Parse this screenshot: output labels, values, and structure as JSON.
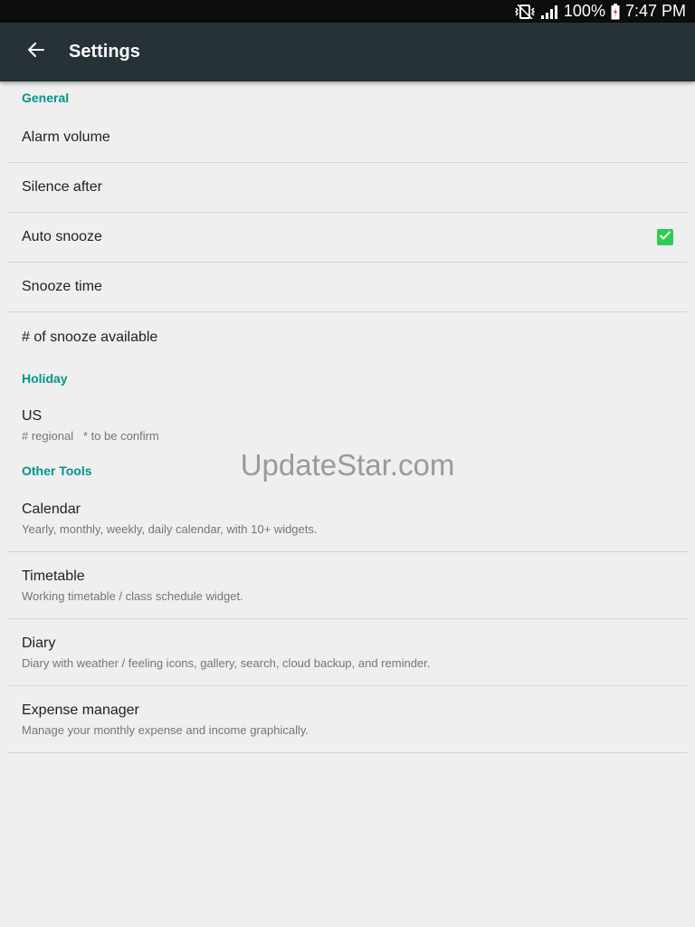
{
  "status_bar": {
    "battery_percent": "100%",
    "time": "7:47 PM",
    "icons": [
      "vibrate-icon",
      "signal-icon",
      "battery-icon"
    ]
  },
  "app_bar": {
    "back_icon": "arrow-back-icon",
    "title": "Settings"
  },
  "sections": {
    "general": {
      "header": "General",
      "alarm_volume": "Alarm volume",
      "silence_after": "Silence after",
      "auto_snooze": "Auto snooze",
      "auto_snooze_checked": true,
      "snooze_time": "Snooze time",
      "snooze_count": "# of snooze available"
    },
    "holiday": {
      "header": "Holiday",
      "us_title": "US",
      "us_subtitle": "# regional   * to be confirm"
    },
    "other_tools": {
      "header": "Other Tools",
      "calendar_title": "Calendar",
      "calendar_subtitle": "Yearly, monthly, weekly, daily calendar, with 10+ widgets.",
      "timetable_title": "Timetable",
      "timetable_subtitle": "Working timetable / class schedule widget.",
      "diary_title": "Diary",
      "diary_subtitle": "Diary with weather / feeling icons, gallery, search, cloud backup, and reminder.",
      "expense_title": "Expense manager",
      "expense_subtitle": "Manage your monthly expense and income graphically."
    }
  },
  "watermark": "UpdateStar.com",
  "colors": {
    "accent": "#009688",
    "app_bar": "#263238",
    "checkbox": "#2ecc52",
    "background": "#efefef"
  }
}
